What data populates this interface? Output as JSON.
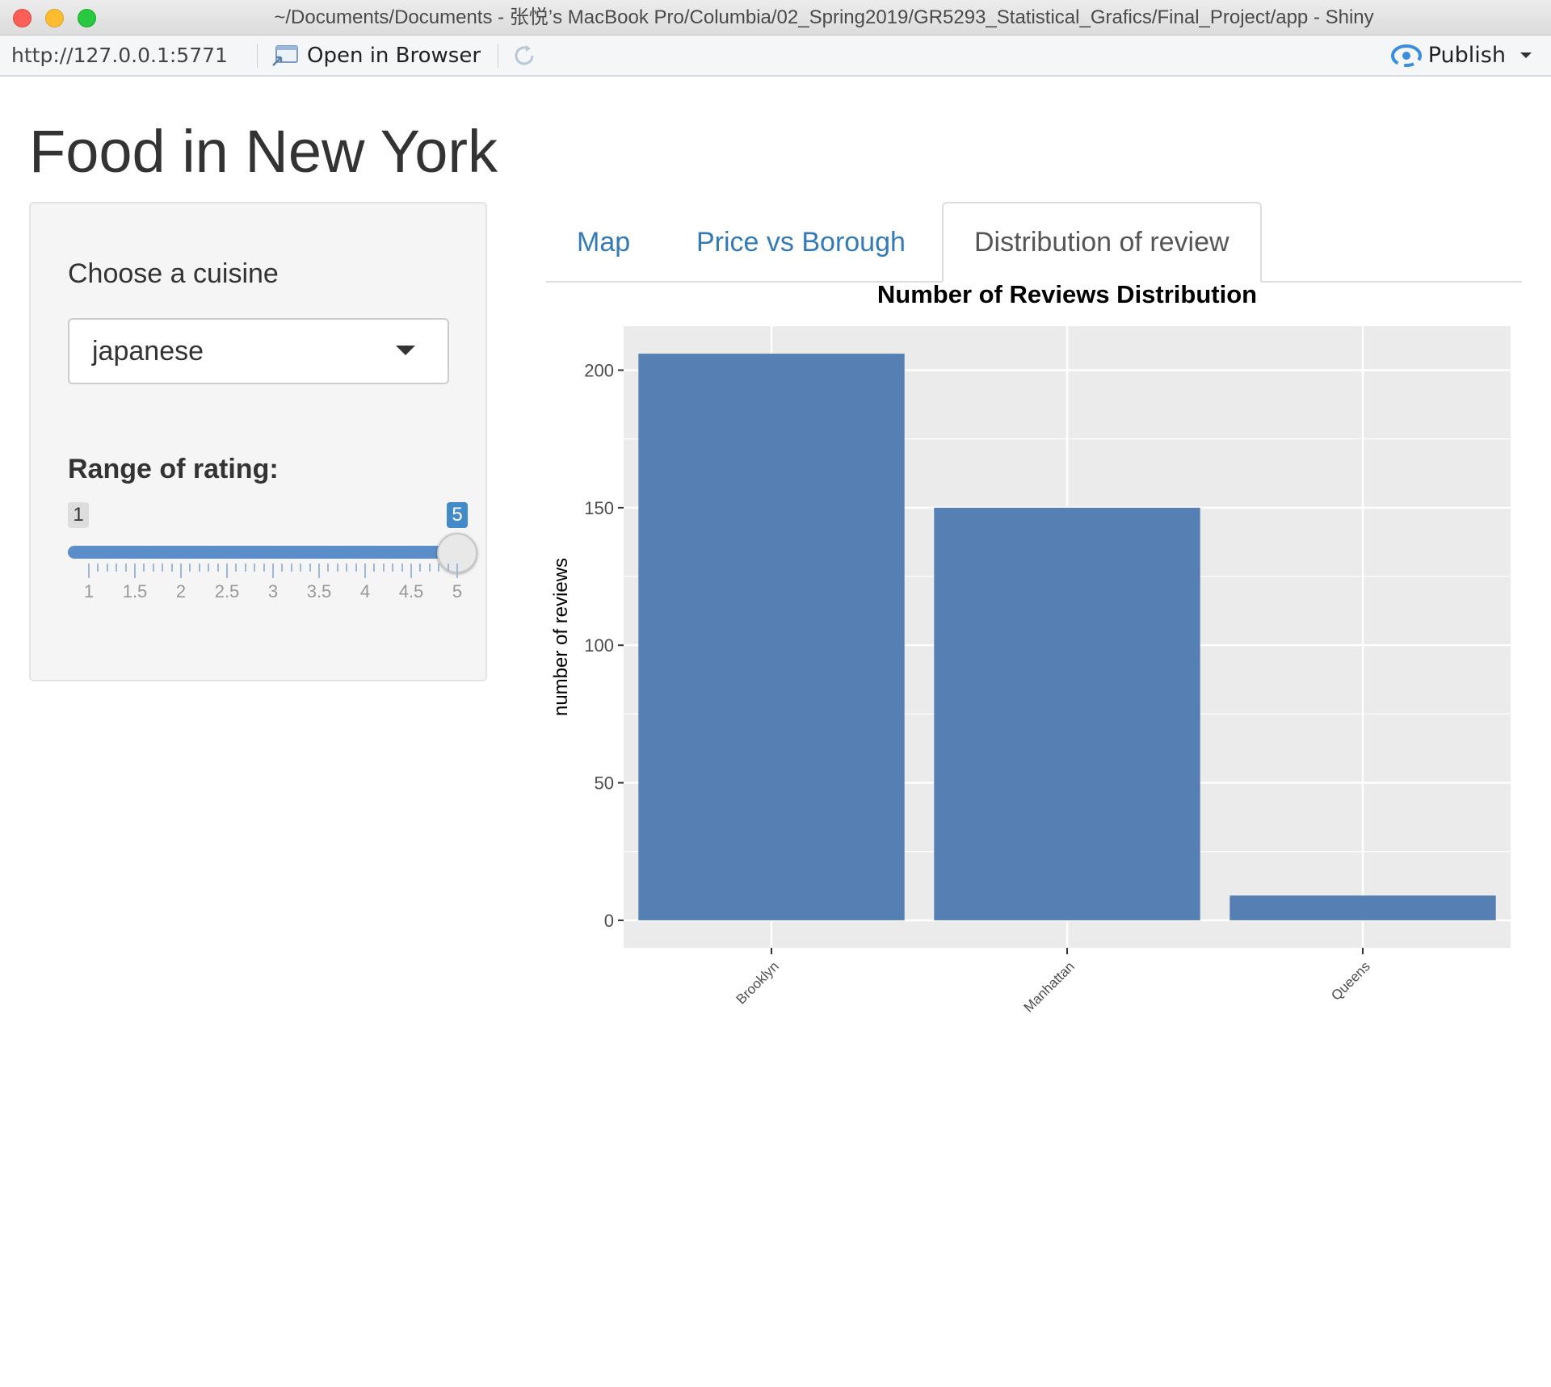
{
  "window": {
    "title": "~/Documents/Documents - 张悦’s MacBook Pro/Columbia/02_Spring2019/GR5293_Statistical_Grafics/Final_Project/app - Shiny"
  },
  "viewer": {
    "url": "http://127.0.0.1:5771",
    "open_in_browser": "Open in Browser",
    "publish": "Publish"
  },
  "app": {
    "title": "Food in New York",
    "sidebar": {
      "cuisine_label": "Choose a cuisine",
      "cuisine_value": "japanese",
      "range_label": "Range of rating:",
      "range_min": "1",
      "range_max": "5",
      "slider_ticks": [
        "1",
        "1.5",
        "2",
        "2.5",
        "3",
        "3.5",
        "4",
        "4.5",
        "5"
      ],
      "slider_accent": "#428bca"
    },
    "tabs": [
      {
        "label": "Map",
        "active": false
      },
      {
        "label": "Price vs Borough",
        "active": false
      },
      {
        "label": "Distribution of review",
        "active": true
      }
    ]
  },
  "chart_data": {
    "type": "bar",
    "title": "Number of Reviews Distribution",
    "xlabel": "",
    "ylabel": "number of reviews",
    "categories": [
      "Brooklyn",
      "Manhattan",
      "Queens"
    ],
    "values": [
      206,
      150,
      9
    ],
    "ylim": [
      -10,
      216
    ],
    "yticks": [
      0,
      50,
      100,
      150,
      200
    ],
    "bar_color": "#5680b3",
    "panel_background": "#ebebeb",
    "grid": true
  }
}
